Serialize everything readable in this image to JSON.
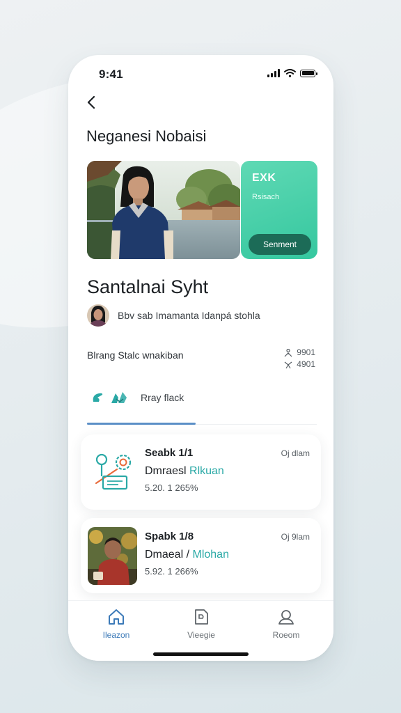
{
  "status_bar": {
    "time": "9:41"
  },
  "page": {
    "title": "Neganesi Nobaisi"
  },
  "promo": {
    "title": "EXK",
    "subtitle": "Rsisach",
    "button_label": "Senment"
  },
  "section": {
    "title": "Santalnai Syht"
  },
  "author": {
    "text": "Bbv sab Imamanta Idanpá stohla"
  },
  "meta": {
    "label": "Blrang Stalc wnakiban",
    "stat1": "9901",
    "stat2": "4901"
  },
  "tabs": {
    "active_label": "Rray flack"
  },
  "cards": [
    {
      "title": "Seabk 1/1",
      "time": "Oj dlam",
      "line_prefix": "Dmraesl",
      "line_accent": "Rlkuan",
      "stats": "5.20. 1 265%"
    },
    {
      "title": "Spabk 1/8",
      "time": "Oj 9lam",
      "line_prefix": "Dmaeal /",
      "line_accent": "Mlohan",
      "stats": "5.92. 1 266%"
    }
  ],
  "nav": [
    {
      "label": "Ileazon",
      "icon": "home-icon",
      "active": true
    },
    {
      "label": "Vieegie",
      "icon": "document-icon",
      "active": false
    },
    {
      "label": "Roeom",
      "icon": "profile-icon",
      "active": false
    }
  ],
  "colors": {
    "accent_teal": "#35c79f",
    "accent_dark": "#1c6b57",
    "link_blue": "#3c7ab8",
    "text_accent": "#2aa9a6"
  }
}
